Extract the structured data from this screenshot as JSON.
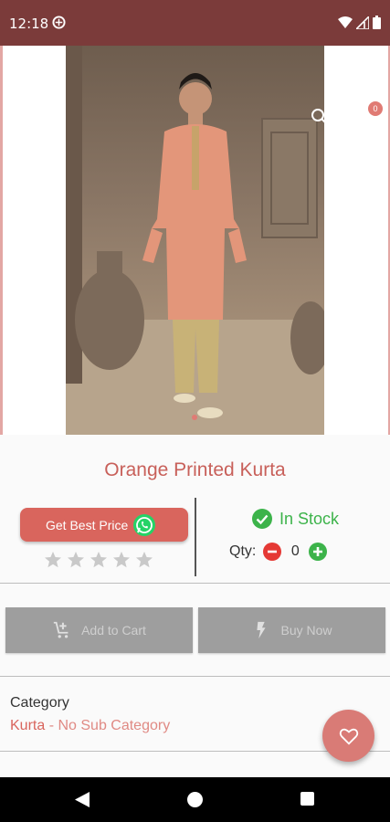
{
  "status_bar": {
    "time": "12:18",
    "icons": [
      "app-icon",
      "wifi-icon",
      "signal-icon",
      "battery-icon"
    ]
  },
  "header": {
    "cart_count": "0",
    "icons": [
      "search-icon",
      "cart-badge"
    ]
  },
  "product": {
    "title": "Orange Printed Kurta",
    "best_price_label": "Get Best Price",
    "rating_stars": 5,
    "rating_value": 0,
    "stock_status": "In Stock",
    "qty_label": "Qty:",
    "qty_value": "0"
  },
  "actions": {
    "add_to_cart": "Add to Cart",
    "buy_now": "Buy Now"
  },
  "category": {
    "label": "Category",
    "name": "Kurta",
    "sub": " - No Sub Category"
  },
  "colors": {
    "status_bar": "#7b3b3a",
    "accent": "#d9655d",
    "in_stock": "#3cb34a",
    "disabled_button": "#9e9e9e"
  }
}
